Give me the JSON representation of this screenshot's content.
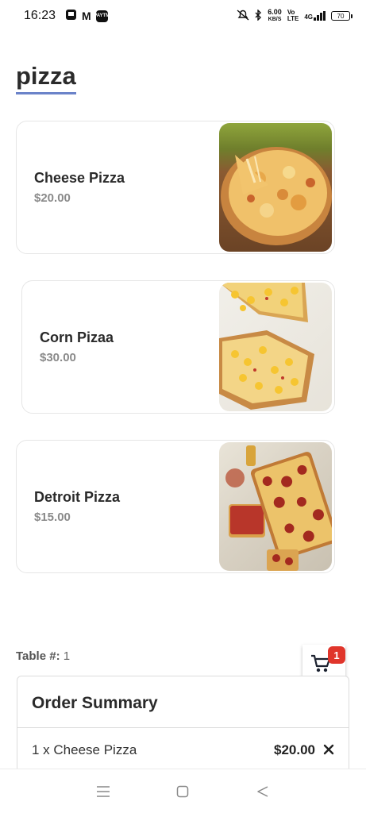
{
  "status_bar": {
    "time": "16:23",
    "gmail_glyph": "M",
    "app_label": "PAYTM",
    "speed_value": "6.00",
    "speed_unit": "KB/S",
    "volte_top": "Vo",
    "volte_bottom": "LTE",
    "network": "4G",
    "battery": "70"
  },
  "page": {
    "title": "pizza"
  },
  "menu": {
    "items": [
      {
        "name": "Cheese Pizza",
        "price": "$20.00"
      },
      {
        "name": "Corn Pizaa",
        "price": "$30.00"
      },
      {
        "name": "Detroit Pizza",
        "price": "$15.00"
      }
    ]
  },
  "table": {
    "label": "Table #:",
    "number": "1"
  },
  "cart": {
    "icon": "cart-icon",
    "count": "1",
    "badge_color": "#e0352b"
  },
  "order_summary": {
    "title": "Order Summary",
    "items": [
      {
        "description": "1 x Cheese Pizza",
        "price": "$20.00"
      }
    ]
  },
  "nav": {
    "icons": [
      "menu-icon",
      "home-icon",
      "back-icon"
    ]
  },
  "colors": {
    "title_underline": "#6b83c9",
    "price_text": "#8a8a8a"
  }
}
